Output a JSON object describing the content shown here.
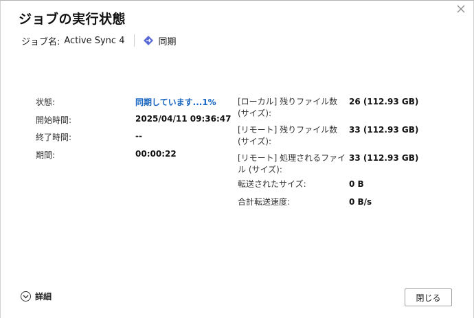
{
  "dialog": {
    "title": "ジョブの実行状態",
    "job_name_label": "ジョブ名:",
    "job_name": "Active Sync 4",
    "sync_type": "同期"
  },
  "left_fields": [
    {
      "label": "状態:",
      "value": "同期しています...1%"
    },
    {
      "label": "開始時間:",
      "value": "2025/04/11 09:36:47"
    },
    {
      "label": "終了時間:",
      "value": "--"
    },
    {
      "label": "期間:",
      "value": "00:00:22"
    }
  ],
  "right_fields": [
    {
      "label_line1": "[ローカル] 残りファイル数",
      "label_line2": "(サイズ):",
      "value": "26 (112.93 GB)"
    },
    {
      "label_line1": "[リモート] 残りファイル数",
      "label_line2": "(サイズ):",
      "value": "33 (112.93 GB)"
    },
    {
      "label_line1": "[リモート] 処理されるファイ",
      "label_line2": "ル (サイズ):",
      "value": "33 (112.93 GB)"
    },
    {
      "label_line1": "転送されたサイズ:",
      "value": "0 B"
    },
    {
      "label_line1": "合計転送速度:",
      "value": "0 B/s"
    }
  ],
  "footer": {
    "details_label": "詳細",
    "close_label": "閉じる"
  },
  "colors": {
    "status_blue": "#1565c0",
    "sync_icon": "#5b6bd6"
  },
  "icons": {
    "close": "close-icon",
    "sync": "sync-diamond-icon",
    "details": "chevron-down-icon"
  }
}
